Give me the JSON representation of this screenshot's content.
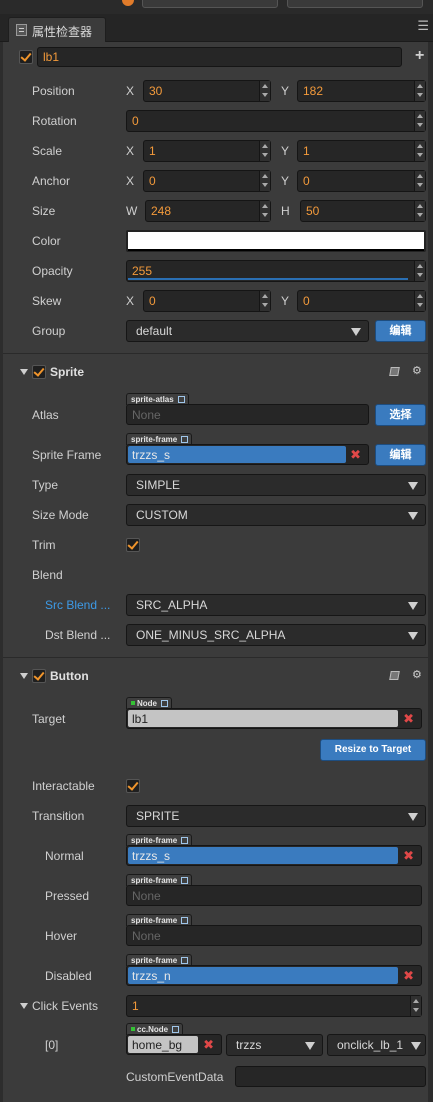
{
  "tab": {
    "title": "属性检查器"
  },
  "node": {
    "enabled": true,
    "name": "lb1"
  },
  "labels": {
    "position": "Position",
    "rotation": "Rotation",
    "scale": "Scale",
    "anchor": "Anchor",
    "size": "Size",
    "color": "Color",
    "opacity": "Opacity",
    "skew": "Skew",
    "group": "Group",
    "x": "X",
    "y": "Y",
    "w": "W",
    "h": "H"
  },
  "transform": {
    "position": {
      "x": "30",
      "y": "182"
    },
    "rotation": "0",
    "scale": {
      "x": "1",
      "y": "1"
    },
    "anchor": {
      "x": "0",
      "y": "0"
    },
    "size": {
      "w": "248",
      "h": "50"
    },
    "color": "#FFFFFF",
    "opacity": "255",
    "skew": {
      "x": "0",
      "y": "0"
    },
    "group": "default",
    "group_edit": "编辑"
  },
  "sprite": {
    "title": "Sprite",
    "atlas_label": "Atlas",
    "atlas_tag": "sprite-atlas",
    "atlas_value": "None",
    "atlas_button": "选择",
    "frame_label": "Sprite Frame",
    "frame_tag": "sprite-frame",
    "frame_value": "trzzs_s",
    "frame_button": "编辑",
    "type_label": "Type",
    "type_value": "SIMPLE",
    "sizemode_label": "Size Mode",
    "sizemode_value": "CUSTOM",
    "trim_label": "Trim",
    "trim_checked": true,
    "blend_label": "Blend",
    "src_label": "Src Blend ...",
    "src_value": "SRC_ALPHA",
    "dst_label": "Dst Blend ...",
    "dst_value": "ONE_MINUS_SRC_ALPHA"
  },
  "button": {
    "title": "Button",
    "target_label": "Target",
    "target_tag": "Node",
    "target_value": "lb1",
    "resize_button": "Resize to Target",
    "interactable_label": "Interactable",
    "interactable_checked": true,
    "transition_label": "Transition",
    "transition_value": "SPRITE",
    "normal_label": "Normal",
    "normal_tag": "sprite-frame",
    "normal_value": "trzzs_s",
    "pressed_label": "Pressed",
    "pressed_tag": "sprite-frame",
    "pressed_value": "None",
    "hover_label": "Hover",
    "hover_tag": "sprite-frame",
    "hover_value": "None",
    "disabled_label": "Disabled",
    "disabled_tag": "sprite-frame",
    "disabled_value": "trzzs_n",
    "click_events_label": "Click Events",
    "click_events_count": "1",
    "event0": {
      "index": "[0]",
      "node_tag": "cc.Node",
      "node_value": "home_bg",
      "component": "trzzs",
      "handler": "onclick_lb_1",
      "custom_label": "CustomEventData",
      "custom_value": ""
    }
  },
  "colors": {
    "accent_orange": "#F39A3B",
    "button_blue": "#3A7BBF",
    "remove_red": "#E04848",
    "blend_label_blue": "#3D9AE6"
  }
}
